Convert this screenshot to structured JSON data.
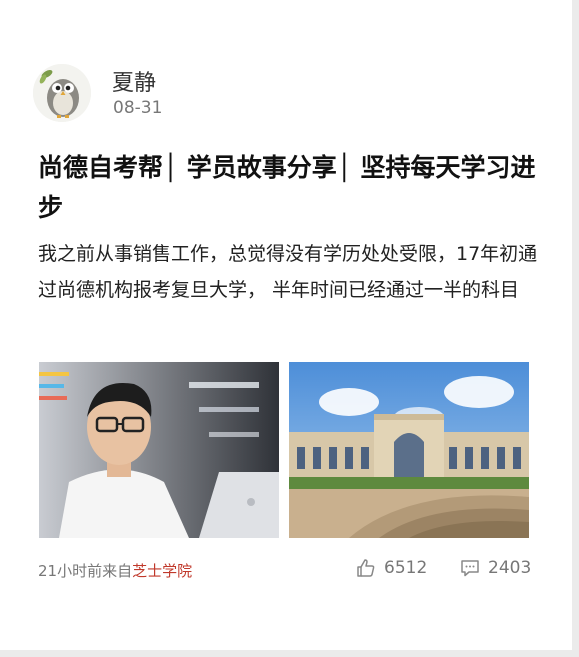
{
  "author": {
    "name": "夏静",
    "date": "08-31",
    "avatar_icon": "owl-avatar-icon"
  },
  "post": {
    "title": "尚德自考帮│ 学员故事分享│ 坚持每天学习进步",
    "body": "我之前从事销售工作，总觉得没有学历处处受限，17年初通过尚德机构报考复旦大学， 半年时间已经通过一半的科目"
  },
  "images": [
    {
      "subject": "young man with glasses using a laptop"
    },
    {
      "subject": "university building with fountain steps"
    }
  ],
  "footer": {
    "time_prefix": "21小时前来自",
    "source": "芝士学院",
    "likes": "6512",
    "comments": "2403",
    "like_icon": "thumbs-up-icon",
    "comment_icon": "comment-bubble-icon"
  },
  "colors": {
    "source_link": "#c0392b",
    "meta_gray": "#777777"
  }
}
